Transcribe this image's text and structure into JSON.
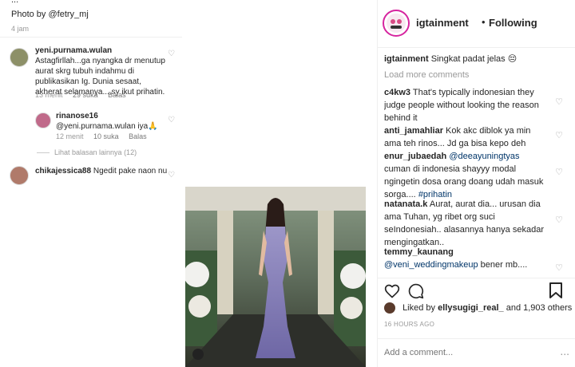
{
  "left_shot": {
    "caption_cut": "...",
    "photo_by": "Photo by @fetry_mj",
    "time": "4 jam",
    "comments": [
      {
        "user": "yeni.purnama.wulan",
        "text": "Astagfirllah...ga nyangka dr menutup aurat skrg tubuh indahmu di publikasikan Ig. Dunia sesaat, akherat selamanya....sy ikut prihatin.",
        "time": "13 menit",
        "likes": "29 suka",
        "reply": "Balas"
      },
      {
        "user": "rinanose16",
        "text": "@yeni.purnama.wulan iya🙏",
        "time": "12 menit",
        "likes": "10 suka",
        "reply": "Balas"
      },
      {
        "user": "chikajessica88",
        "text": "Ngedit pake naon nu",
        "time": "",
        "likes": "",
        "reply": ""
      }
    ],
    "more_replies": "Lihat balasan lainnya (12)"
  },
  "post": {
    "username": "igtainment",
    "separator": "•",
    "following": "Following",
    "caption_user": "igtainment",
    "caption_text": "Singkat padat jelas 😔",
    "load_more": "Load more comments",
    "comments": [
      {
        "user": "c4kw3",
        "text": "That's typically indonesian they judge people without looking the reason behind it"
      },
      {
        "user": "anti_jamahliar",
        "text": "Kok akc diblok ya min ama teh rinos... Jd ga bisa kepo deh"
      },
      {
        "user": "enur_jubaedah",
        "mention": "@deeayuningtyas",
        "text": "cuman di indonesia shayyy modal ngingetin dosa orang doang udah masuk sorga....",
        "tag": "#prihatin"
      },
      {
        "user": "natanata.k",
        "text": "Aurat, aurat dia... urusan dia ama Tuhan, yg ribet org suci seIndonesiah.. alasannya hanya sekadar mengingatkan.."
      },
      {
        "user": "temmy_kaunang",
        "mention": "@veni_weddingmakeup",
        "text": "bener mb...."
      }
    ],
    "liked_by_prefix": "Liked by",
    "liked_by_user": "ellysugigi_real_",
    "liked_by_suffix": "and 1,903 others",
    "time": "16 HOURS AGO",
    "add_comment_placeholder": "Add a comment...",
    "more_icon": "...",
    "heart_glyph": "♡"
  },
  "colors": {
    "accent_story_ring": "#d6249f",
    "text": "#262626",
    "muted": "#999999",
    "mention": "#003569"
  }
}
